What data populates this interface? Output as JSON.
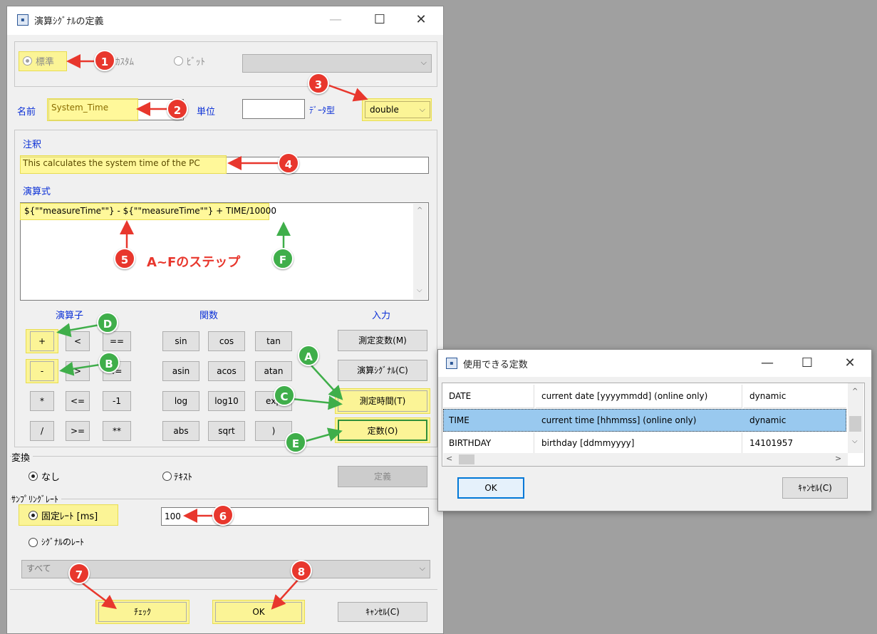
{
  "main_window": {
    "title": "演算ｼｸﾞﾅﾙの定義",
    "type_standard": "標準",
    "type_custom": "ｶｽﾀﾑ",
    "type_bit": "ﾋﾞｯﾄ",
    "name_label": "名前",
    "name_value": "System_Time",
    "unit_label": "単位",
    "unit_value": "",
    "datatype_label": "ﾃﾞｰﾀ型",
    "datatype_value": "double",
    "comment_label": "注釈",
    "comment_value": "This calculates the system time of the PC",
    "formula_label": "演算式",
    "formula_value": "${\"\"measureTime\"\"} - ${\"\"measureTime\"\"} + TIME/10000",
    "operators_header": "演算子",
    "functions_header": "関数",
    "input_header": "入力",
    "operators": [
      "+",
      "<",
      "==",
      "-",
      ">",
      "!=",
      "*",
      "<=",
      "-1",
      "/",
      ">=",
      "**"
    ],
    "functions": [
      "sin",
      "cos",
      "tan",
      "asin",
      "acos",
      "atan",
      "log",
      "log10",
      "exp",
      "abs",
      "sqrt",
      ")"
    ],
    "input_buttons": [
      "測定変数(M)",
      "演算ｼｸﾞﾅﾙ(C)",
      "測定時間(T)",
      "定数(O)"
    ],
    "conversion_label": "変換",
    "conv_none": "なし",
    "conv_text": "ﾃｷｽﾄ",
    "define_button": "定義",
    "sampling_label": "ｻﾝﾌﾟﾘﾝｸﾞﾚｰﾄ",
    "fixed_rate_label": "固定ﾚｰﾄ [ms]",
    "fixed_rate_value": "100",
    "signal_rate_label": "ｼｸﾞﾅﾙのﾚｰﾄ",
    "signal_select_value": "すべて",
    "check_button": "ﾁｪｯｸ",
    "ok_button": "OK",
    "cancel_button": "ｷｬﾝｾﾙ(C)"
  },
  "constants_window": {
    "title": "使用できる定数",
    "rows": [
      {
        "name": "DATE",
        "desc": "current date [yyyymmdd] (online only)",
        "value": "dynamic"
      },
      {
        "name": "TIME",
        "desc": "current time [hhmmss] (online only)",
        "value": "dynamic"
      },
      {
        "name": "BIRTHDAY",
        "desc": "birthday [ddmmyyyy]",
        "value": "14101957"
      }
    ],
    "ok_button": "OK",
    "cancel_button": "ｷｬﾝｾﾙ(C)"
  },
  "annotations": {
    "steps_text": "A~Fのステップ",
    "numbers": [
      "1",
      "2",
      "3",
      "4",
      "5",
      "6",
      "7",
      "8"
    ],
    "letters": [
      "A",
      "B",
      "C",
      "D",
      "E",
      "F"
    ]
  },
  "colors": {
    "highlight": "#fff678",
    "red_badge": "#e8372d",
    "green_badge": "#3fae4a",
    "label_blue": "#0a2fd6",
    "selection": "#99c9ef"
  }
}
